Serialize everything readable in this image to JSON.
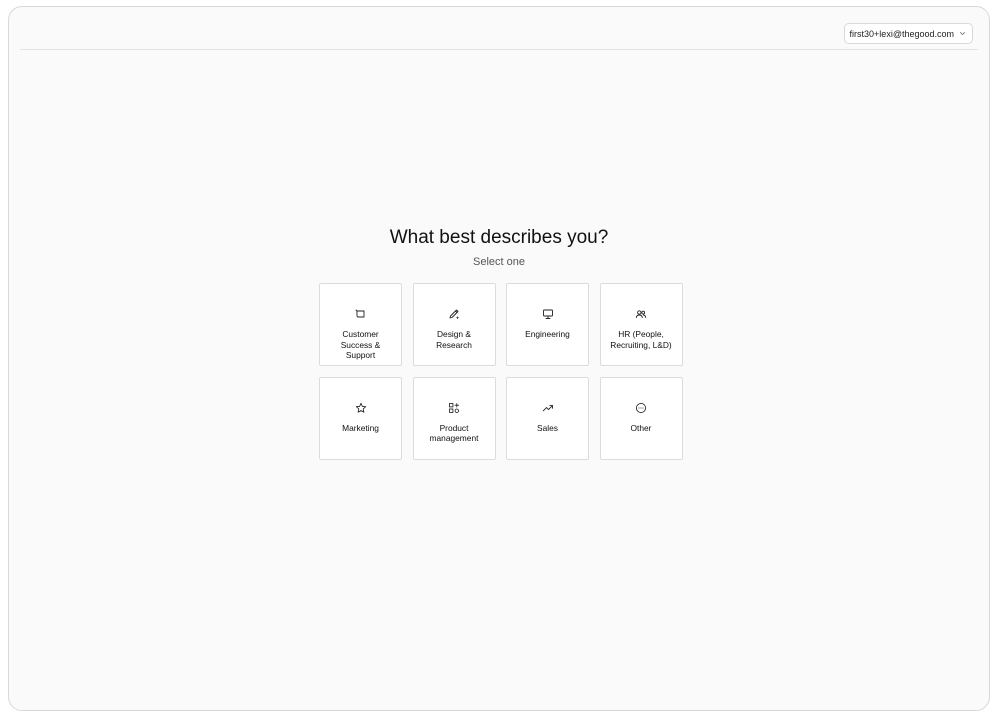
{
  "header": {
    "account_email": "first30+lexi@thegood.com"
  },
  "main": {
    "title": "What best describes you?",
    "subtitle": "Select one",
    "options": [
      {
        "label": "Customer Success & Support",
        "icon": "tag-icon"
      },
      {
        "label": "Design & Research",
        "icon": "pen-icon"
      },
      {
        "label": "Engineering",
        "icon": "monitor-icon"
      },
      {
        "label": "HR (People, Recruiting, L&D)",
        "icon": "users-icon"
      },
      {
        "label": "Marketing",
        "icon": "star-icon"
      },
      {
        "label": "Product management",
        "icon": "shapes-icon"
      },
      {
        "label": "Sales",
        "icon": "trend-up-icon"
      },
      {
        "label": "Other",
        "icon": "ellipsis-circle-icon"
      }
    ]
  }
}
